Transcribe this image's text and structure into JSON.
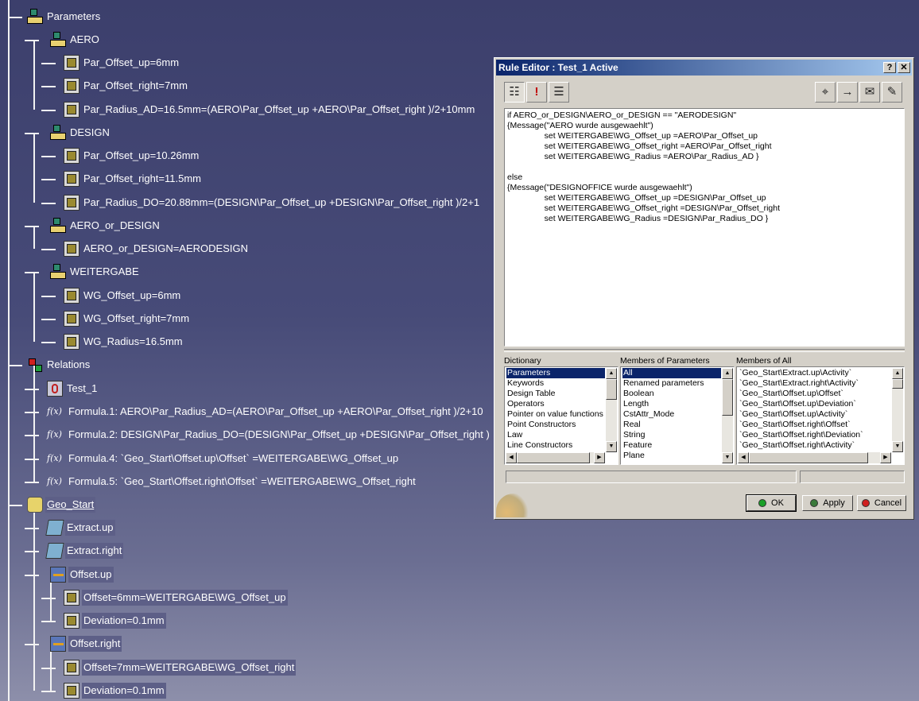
{
  "tree": {
    "nodes": [
      {
        "id": "parameters",
        "label": "Parameters",
        "icon": "parameter-set-icon"
      },
      {
        "id": "aero",
        "label": "AERO",
        "icon": "parameter-set-icon"
      },
      {
        "id": "aero-offset-up",
        "label": "Par_Offset_up=6mm",
        "icon": "length-parameter-icon"
      },
      {
        "id": "aero-offset-right",
        "label": "Par_Offset_right=7mm",
        "icon": "length-parameter-icon"
      },
      {
        "id": "aero-radius",
        "label": "Par_Radius_AD=16.5mm=(AERO\\Par_Offset_up +AERO\\Par_Offset_right )/2+10mm",
        "icon": "formula-parameter-icon"
      },
      {
        "id": "design",
        "label": "DESIGN",
        "icon": "parameter-set-icon"
      },
      {
        "id": "design-offset-up",
        "label": "Par_Offset_up=10.26mm",
        "icon": "length-parameter-icon"
      },
      {
        "id": "design-offset-right",
        "label": "Par_Offset_right=11.5mm",
        "icon": "length-parameter-icon"
      },
      {
        "id": "design-radius",
        "label": "Par_Radius_DO=20.88mm=(DESIGN\\Par_Offset_up +DESIGN\\Par_Offset_right )/2+1",
        "icon": "formula-parameter-icon"
      },
      {
        "id": "aero-or-design",
        "label": "AERO_or_DESIGN",
        "icon": "parameter-set-icon"
      },
      {
        "id": "aero-or-design-value",
        "label": "AERO_or_DESIGN=AERODESIGN",
        "icon": "string-parameter-icon"
      },
      {
        "id": "weitergabe",
        "label": "WEITERGABE",
        "icon": "parameter-set-icon"
      },
      {
        "id": "wg-offset-up",
        "label": "WG_Offset_up=6mm",
        "icon": "formula-parameter-icon"
      },
      {
        "id": "wg-offset-right",
        "label": "WG_Offset_right=7mm",
        "icon": "formula-parameter-icon"
      },
      {
        "id": "wg-radius",
        "label": "WG_Radius=16.5mm",
        "icon": "formula-parameter-icon"
      },
      {
        "id": "relations",
        "label": "Relations",
        "icon": "relations-icon"
      },
      {
        "id": "test1",
        "label": "Test_1",
        "icon": "rule-icon"
      },
      {
        "id": "formula1",
        "label": "Formula.1: AERO\\Par_Radius_AD=(AERO\\Par_Offset_up +AERO\\Par_Offset_right )/2+10",
        "icon": "formula-icon"
      },
      {
        "id": "formula2",
        "label": "Formula.2: DESIGN\\Par_Radius_DO=(DESIGN\\Par_Offset_up +DESIGN\\Par_Offset_right )",
        "icon": "formula-icon"
      },
      {
        "id": "formula4",
        "label": "Formula.4: `Geo_Start\\Offset.up\\Offset` =WEITERGABE\\WG_Offset_up",
        "icon": "formula-icon"
      },
      {
        "id": "formula5",
        "label": "Formula.5: `Geo_Start\\Offset.right\\Offset` =WEITERGABE\\WG_Offset_right",
        "icon": "formula-icon"
      },
      {
        "id": "geo-start",
        "label": "Geo_Start",
        "icon": "geometrical-set-icon"
      },
      {
        "id": "extract-up",
        "label": "Extract.up",
        "icon": "extract-icon"
      },
      {
        "id": "extract-right",
        "label": "Extract.right",
        "icon": "extract-icon"
      },
      {
        "id": "offset-up",
        "label": "Offset.up",
        "icon": "offset-icon"
      },
      {
        "id": "offset-up-offset",
        "label": "Offset=6mm=WEITERGABE\\WG_Offset_up",
        "icon": "formula-parameter-icon"
      },
      {
        "id": "offset-up-deviation",
        "label": "Deviation=0.1mm",
        "icon": "length-parameter-icon"
      },
      {
        "id": "offset-right",
        "label": "Offset.right",
        "icon": "offset-icon"
      },
      {
        "id": "offset-right-offset",
        "label": "Offset=7mm=WEITERGABE\\WG_Offset_right",
        "icon": "formula-parameter-icon"
      },
      {
        "id": "offset-right-deviation",
        "label": "Deviation=0.1mm",
        "icon": "length-parameter-icon"
      }
    ]
  },
  "dialog": {
    "title": "Rule Editor : Test_1 Active",
    "help_label": "?",
    "close_label": "✕",
    "editor_text": "if AERO_or_DESIGN\\AERO_or_DESIGN == \"AERODESIGN\"\n{Message(\"AERO wurde ausgewaehlt\")\n                set WEITERGABE\\WG_Offset_up =AERO\\Par_Offset_up\n                set WEITERGABE\\WG_Offset_right =AERO\\Par_Offset_right\n                set WEITERGABE\\WG_Radius =AERO\\Par_Radius_AD }\n\nelse\n{Message(\"DESIGNOFFICE wurde ausgewaehlt\")\n                set WEITERGABE\\WG_Offset_up =DESIGN\\Par_Offset_up\n                set WEITERGABE\\WG_Offset_right =DESIGN\\Par_Offset_right\n                set WEITERGABE\\WG_Radius =DESIGN\\Par_Radius_DO }",
    "dictionary": {
      "header": "Dictionary",
      "items": [
        "Parameters",
        "Keywords",
        "Design Table",
        "Operators",
        "Pointer on value functions",
        "Point Constructors",
        "Law",
        "Line Constructors"
      ],
      "selected": "Parameters"
    },
    "members_params": {
      "header": "Members of Parameters",
      "items": [
        "All",
        "Renamed parameters",
        "Boolean",
        "Length",
        "CstAttr_Mode",
        "Real",
        "String",
        "Feature",
        "Plane"
      ],
      "selected": "All"
    },
    "members_all": {
      "header": "Members of All",
      "items": [
        "`Geo_Start\\Extract.up\\Activity`",
        "`Geo_Start\\Extract.right\\Activity`",
        "`Geo_Start\\Offset.up\\Offset`",
        "`Geo_Start\\Offset.up\\Deviation`",
        "`Geo_Start\\Offset.up\\Activity`",
        "`Geo_Start\\Offset.right\\Offset`",
        "`Geo_Start\\Offset.right\\Deviation`",
        "`Geo_Start\\Offset.right\\Activity`"
      ]
    },
    "buttons": {
      "ok": "OK",
      "apply": "Apply",
      "cancel": "Cancel"
    },
    "colors": {
      "ok": "#1aa028",
      "apply": "#3a7a3a",
      "cancel": "#d02020",
      "title_start": "#0a246a",
      "title_end": "#a6caf0"
    }
  }
}
